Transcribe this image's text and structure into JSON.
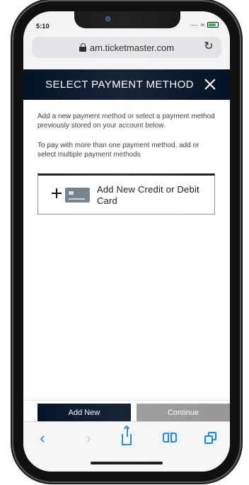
{
  "status_bar": {
    "time": "5:10"
  },
  "browser": {
    "address": "am.ticketmaster.com"
  },
  "page": {
    "title": "SELECT PAYMENT METHOD",
    "intro": "Add a new payment method or select a payment method previously stored on your account below.",
    "multi_payment": "To pay with more than one payment method, add or select multiple payment methods",
    "add_card_label": "Add New Credit or Debit Card"
  },
  "actions": {
    "add_new": "Add New",
    "continue": "Continue"
  },
  "icons": {
    "lock": "lock-icon",
    "reload": "reload-icon",
    "close": "close-icon",
    "plus": "plus-icon",
    "card": "credit-card-icon",
    "back": "back-icon",
    "forward": "forward-icon",
    "share": "share-icon",
    "bookmarks": "bookmarks-icon",
    "tabs": "tabs-icon"
  },
  "colors": {
    "header": "#031326",
    "primary_button": "#031326",
    "continue_disabled": "#979797",
    "safari_blue": "#0a84ff"
  }
}
